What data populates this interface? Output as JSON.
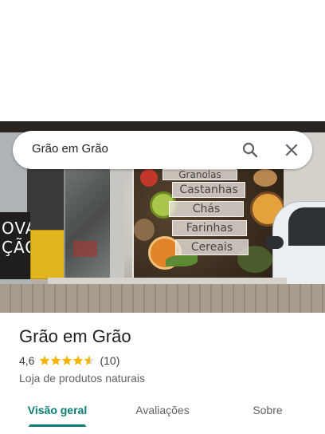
{
  "search": {
    "query": "Grão em Grão"
  },
  "photo": {
    "mural_labels": [
      "Granolas",
      "Castanhas",
      "Chás",
      "Farinhas",
      "Cereais"
    ],
    "chalkboard_text": "OVA\nÇÃO"
  },
  "place": {
    "name": "Grão em Grão",
    "rating": "4,6",
    "rating_value": 4.6,
    "stars_max": 5,
    "review_count": "(10)",
    "category": "Loja de produtos naturais"
  },
  "tabs": [
    {
      "label": "Visão geral",
      "active": true
    },
    {
      "label": "Avaliações",
      "active": false
    },
    {
      "label": "Sobre",
      "active": false
    }
  ],
  "colors": {
    "accent": "#0b7c72",
    "star": "#f4b400",
    "star_empty": "#dadce0"
  }
}
